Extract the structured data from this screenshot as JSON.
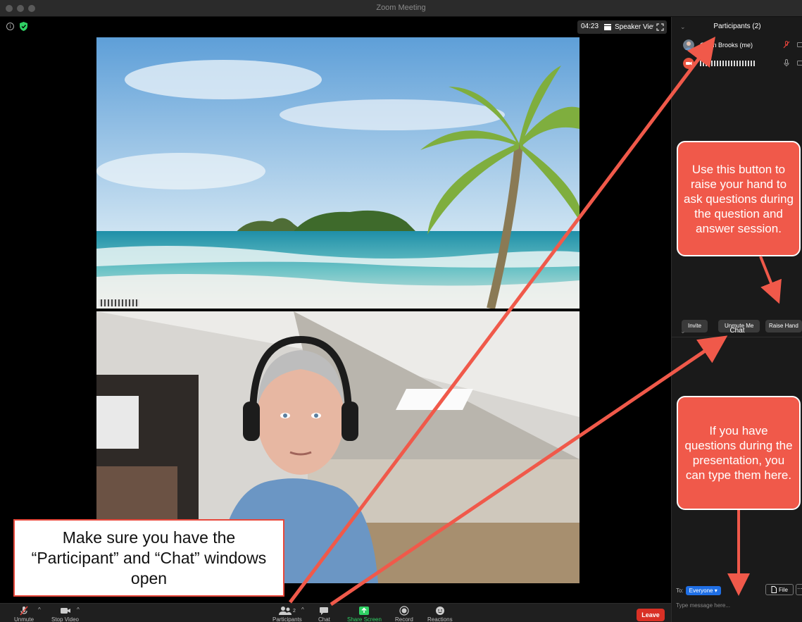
{
  "window": {
    "title": "Zoom Meeting"
  },
  "meeting": {
    "timer": "04:23",
    "speaker_view_label": "Speaker View"
  },
  "toolbar": {
    "unmute": "Unmute",
    "stop_video": "Stop Video",
    "participants": "Participants",
    "participant_count": "2",
    "chat": "Chat",
    "share_screen": "Share Screen",
    "record": "Record",
    "reactions": "Reactions",
    "leave": "Leave"
  },
  "participants_panel": {
    "title": "Participants (2)",
    "people": [
      {
        "name": "Gavin Brooks (me)"
      }
    ],
    "buttons": {
      "invite": "Invite",
      "unmute_me": "Unmute Me",
      "raise_hand": "Raise Hand"
    }
  },
  "chat_panel": {
    "title": "Chat",
    "to_label": "To:",
    "recipient": "Everyone",
    "file_label": "File",
    "more_label": "···",
    "placeholder": "Type message here..."
  },
  "annotations": {
    "raise_hand_note": "Use this button to raise your hand to ask questions during the question and answer session.",
    "chat_note": "If you have questions during the presentation, you can type them here.",
    "windows_note": "Make sure you have the “Participant” and “Chat” windows open"
  },
  "colors": {
    "accent_blue": "#1f6fe5",
    "leave_red": "#d93025",
    "callout_red": "#f0594a",
    "share_green": "#2fd164"
  }
}
